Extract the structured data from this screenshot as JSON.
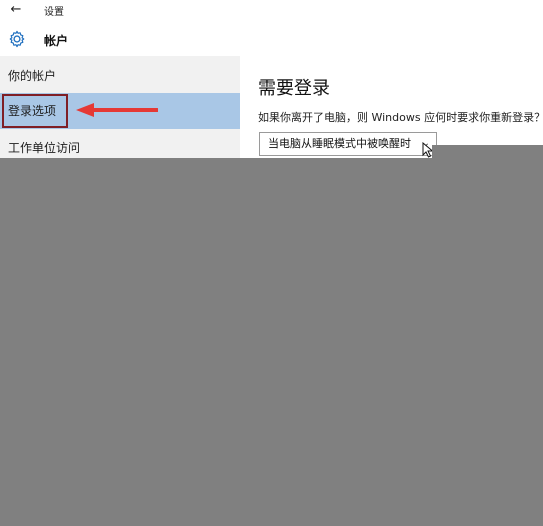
{
  "window": {
    "title": "设置"
  },
  "header": {
    "title": "帐户"
  },
  "sidebar": {
    "items": [
      {
        "label": "你的帐户"
      },
      {
        "label": "登录选项"
      },
      {
        "label": "工作单位访问"
      }
    ]
  },
  "main": {
    "title": "需要登录",
    "description": "如果你离开了电脑，则 Windows 应何时要求你重新登录？",
    "dropdown_value": "当电脑从睡眠模式中被唤醒时"
  },
  "colors": {
    "accent": "#a9c7e6",
    "highlight_border": "#7f1f26",
    "annotation_arrow": "#e53935",
    "overlay": "#808080"
  },
  "icons": {
    "back": "back-arrow-icon",
    "settings": "gear-icon",
    "dropdown": "chevron-down-icon",
    "cursor": "cursor-icon"
  }
}
